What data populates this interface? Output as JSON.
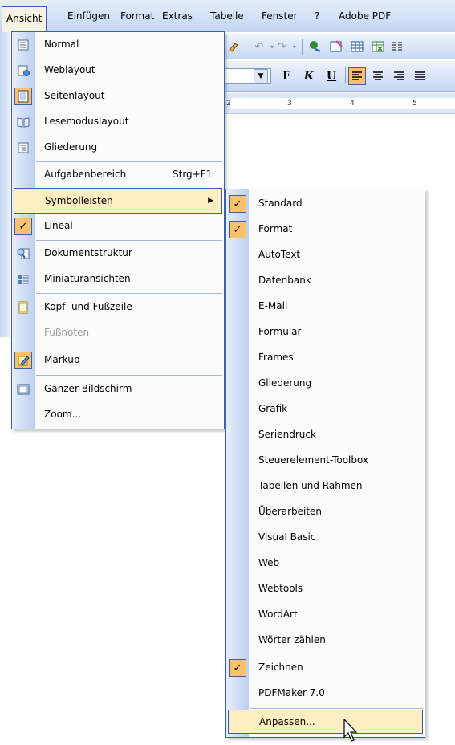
{
  "menubar": {
    "items": [
      {
        "label": "Ansicht",
        "active": true
      },
      {
        "label": "Einfügen"
      },
      {
        "label": "Format"
      },
      {
        "label": "Extras"
      },
      {
        "label": "Tabelle"
      },
      {
        "label": "Fenster"
      },
      {
        "label": "?"
      },
      {
        "label": "Adobe PDF"
      }
    ]
  },
  "format_toolbar": {
    "bold": "F",
    "italic": "K",
    "underline": "U"
  },
  "ruler": {
    "ticks": [
      "2",
      "3",
      "4",
      "5"
    ]
  },
  "view_menu": {
    "items": [
      {
        "label": "Normal",
        "icon": "normal-view-icon"
      },
      {
        "label": "Weblayout",
        "icon": "web-layout-icon"
      },
      {
        "label": "Seitenlayout",
        "icon": "page-layout-icon",
        "selected": true
      },
      {
        "label": "Lesemoduslayout",
        "icon": "reading-mode-icon"
      },
      {
        "label": "Gliederung",
        "icon": "outline-icon"
      },
      {
        "label": "Aufgabenbereich",
        "shortcut": "Strg+F1"
      },
      {
        "label": "Symbolleisten",
        "has_submenu": true,
        "highlighted": true
      },
      {
        "label": "Lineal",
        "checked": true
      },
      {
        "label": "Dokumentstruktur",
        "icon": "document-map-icon"
      },
      {
        "label": "Miniaturansichten",
        "icon": "thumbnails-icon"
      },
      {
        "label": "Kopf- und Fußzeile",
        "icon": "header-footer-icon"
      },
      {
        "label": "Fußnoten",
        "disabled": true
      },
      {
        "label": "Markup",
        "icon": "markup-icon",
        "selected": true
      },
      {
        "label": "Ganzer Bildschirm",
        "icon": "full-screen-icon"
      },
      {
        "label": "Zoom..."
      }
    ]
  },
  "toolbars_submenu": {
    "items": [
      {
        "label": "Standard",
        "checked": true
      },
      {
        "label": "Format",
        "checked": true
      },
      {
        "label": "AutoText"
      },
      {
        "label": "Datenbank"
      },
      {
        "label": "E-Mail"
      },
      {
        "label": "Formular"
      },
      {
        "label": "Frames"
      },
      {
        "label": "Gliederung"
      },
      {
        "label": "Grafik"
      },
      {
        "label": "Seriendruck"
      },
      {
        "label": "Steuerelement-Toolbox"
      },
      {
        "label": "Tabellen und Rahmen"
      },
      {
        "label": "Überarbeiten"
      },
      {
        "label": "Visual Basic"
      },
      {
        "label": "Web"
      },
      {
        "label": "Webtools"
      },
      {
        "label": "WordArt"
      },
      {
        "label": "Wörter zählen"
      },
      {
        "label": "Zeichnen",
        "checked": true
      },
      {
        "label": "PDFMaker 7.0"
      },
      {
        "label": "Anpassen...",
        "highlighted": true
      }
    ]
  },
  "colors": {
    "menu_border": "#3c5fae",
    "highlight": "#ffeec2",
    "check_bg": "#ffc06a"
  }
}
